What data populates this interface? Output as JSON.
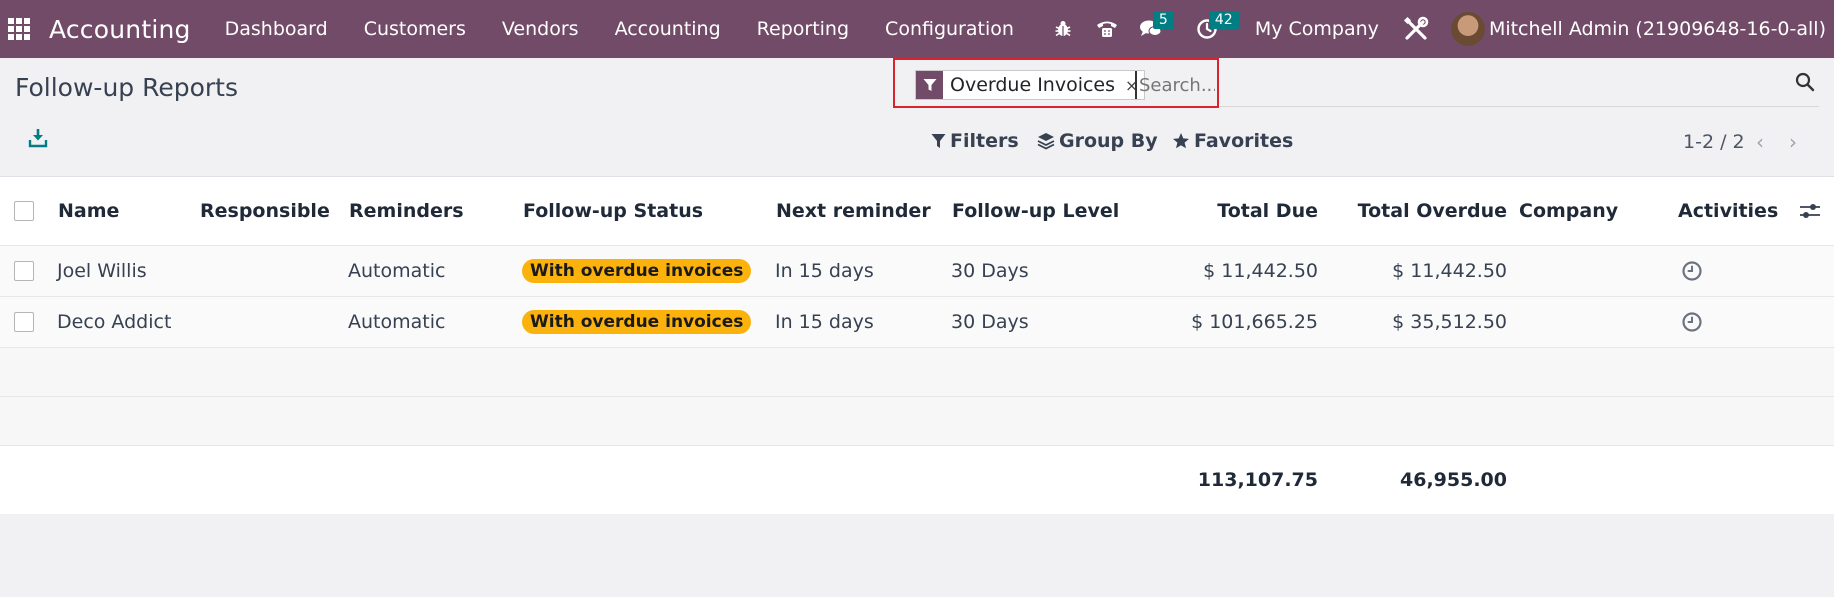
{
  "navbar": {
    "app_name": "Accounting",
    "menu": [
      "Dashboard",
      "Customers",
      "Vendors",
      "Accounting",
      "Reporting",
      "Configuration"
    ],
    "messages_count": "5",
    "activities_count": "42",
    "company": "My Company",
    "user": "Mitchell Admin (21909648-16-0-all)"
  },
  "page": {
    "title": "Follow-up Reports"
  },
  "search": {
    "facet_label": "Overdue Invoices",
    "facet_close": "×",
    "placeholder": "Search..."
  },
  "toolbar": {
    "filters_label": "Filters",
    "group_by_label": "Group By",
    "favorites_label": "Favorites",
    "pager": "1-2 / 2",
    "pager_prev": "‹",
    "pager_next": "›"
  },
  "table": {
    "headers": {
      "name": "Name",
      "responsible": "Responsible",
      "reminders": "Reminders",
      "status": "Follow-up Status",
      "next_reminder": "Next reminder",
      "level": "Follow-up Level",
      "total_due": "Total Due",
      "total_overdue": "Total Overdue",
      "company": "Company",
      "activities": "Activities"
    },
    "rows": [
      {
        "name": "Joel Willis",
        "reminders": "Automatic",
        "status": "With overdue invoices",
        "next_reminder": "In 15 days",
        "level": "30 Days",
        "total_due": "$ 11,442.50",
        "total_overdue": "$ 11,442.50"
      },
      {
        "name": "Deco Addict",
        "reminders": "Automatic",
        "status": "With overdue invoices",
        "next_reminder": "In 15 days",
        "level": "30 Days",
        "total_due": "$ 101,665.25",
        "total_overdue": "$ 35,512.50"
      }
    ],
    "totals": {
      "total_due": "113,107.75",
      "total_overdue": "46,955.00"
    }
  },
  "colors": {
    "navbar": "#714b67",
    "badge": "#017e84",
    "status_badge": "#fbb20c",
    "highlight_border": "#d9232e"
  }
}
